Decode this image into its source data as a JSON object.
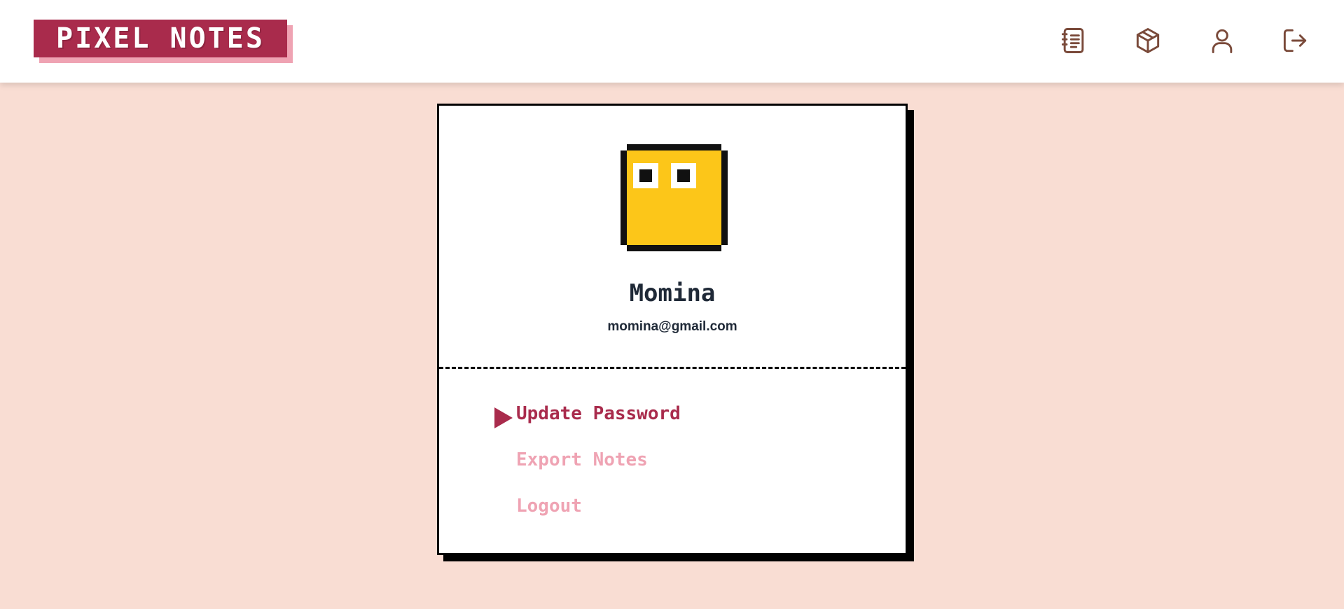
{
  "app": {
    "logo_text": "PIXEL NOTES"
  },
  "header": {
    "icons": [
      {
        "name": "notebook-icon"
      },
      {
        "name": "box-icon"
      },
      {
        "name": "user-icon"
      },
      {
        "name": "logout-icon"
      }
    ]
  },
  "profile": {
    "name": "Momina",
    "email": "momina@gmail.com",
    "avatar": "pixel-yellow-face"
  },
  "menu": {
    "active_index": 0,
    "items": [
      {
        "label": "Update Password"
      },
      {
        "label": "Export Notes"
      },
      {
        "label": "Logout"
      }
    ]
  },
  "colors": {
    "brand": "#a92b4c",
    "brand_light": "#efa3b3",
    "page_bg": "#f9ddd3",
    "icon": "#7a4a3a",
    "avatar_yellow": "#fcc619"
  }
}
